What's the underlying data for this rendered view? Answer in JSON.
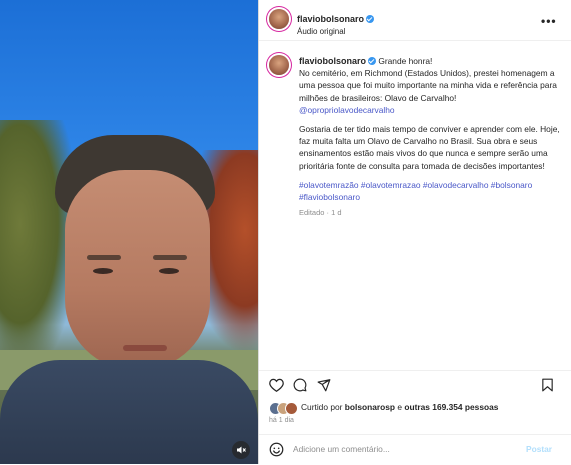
{
  "header": {
    "username": "flaviobolsonaro",
    "audio": "Áudio original",
    "more": "•••"
  },
  "caption": {
    "username": "flaviobolsonaro",
    "line1": "Grande honra!",
    "p1": "No cemitério, em Richmond (Estados Unidos), prestei homenagem a uma pessoa que foi muito importante na minha vida e referência para milhões de brasileiros: Olavo de Carvalho!",
    "mention": "@opropriolavodecarvalho",
    "p2": "Gostaria de ter tido mais tempo de conviver e aprender com ele. Hoje, faz muita falta um Olavo de Carvalho no Brasil. Sua obra e seus ensinamentos estão mais vivos do que nunca e sempre serão uma prioritária fonte de consulta para tomada de decisões importantes!",
    "hashtags": "#olavotemrazão #olavotemrazao #olavodecarvalho #bolsonaro #flaviobolsonaro",
    "meta": "Editado · 1 d"
  },
  "likes": {
    "prefix": "Curtido por",
    "user": "bolsonarosp",
    "middle": "e",
    "others": "outras 169.354 pessoas"
  },
  "time_ago": "há 1 dia",
  "comment": {
    "placeholder": "Adicione um comentário...",
    "post": "Postar"
  },
  "colors": {
    "link": "#4a58c8",
    "verified": "#3897f0",
    "post_disabled": "#b2dffc"
  }
}
